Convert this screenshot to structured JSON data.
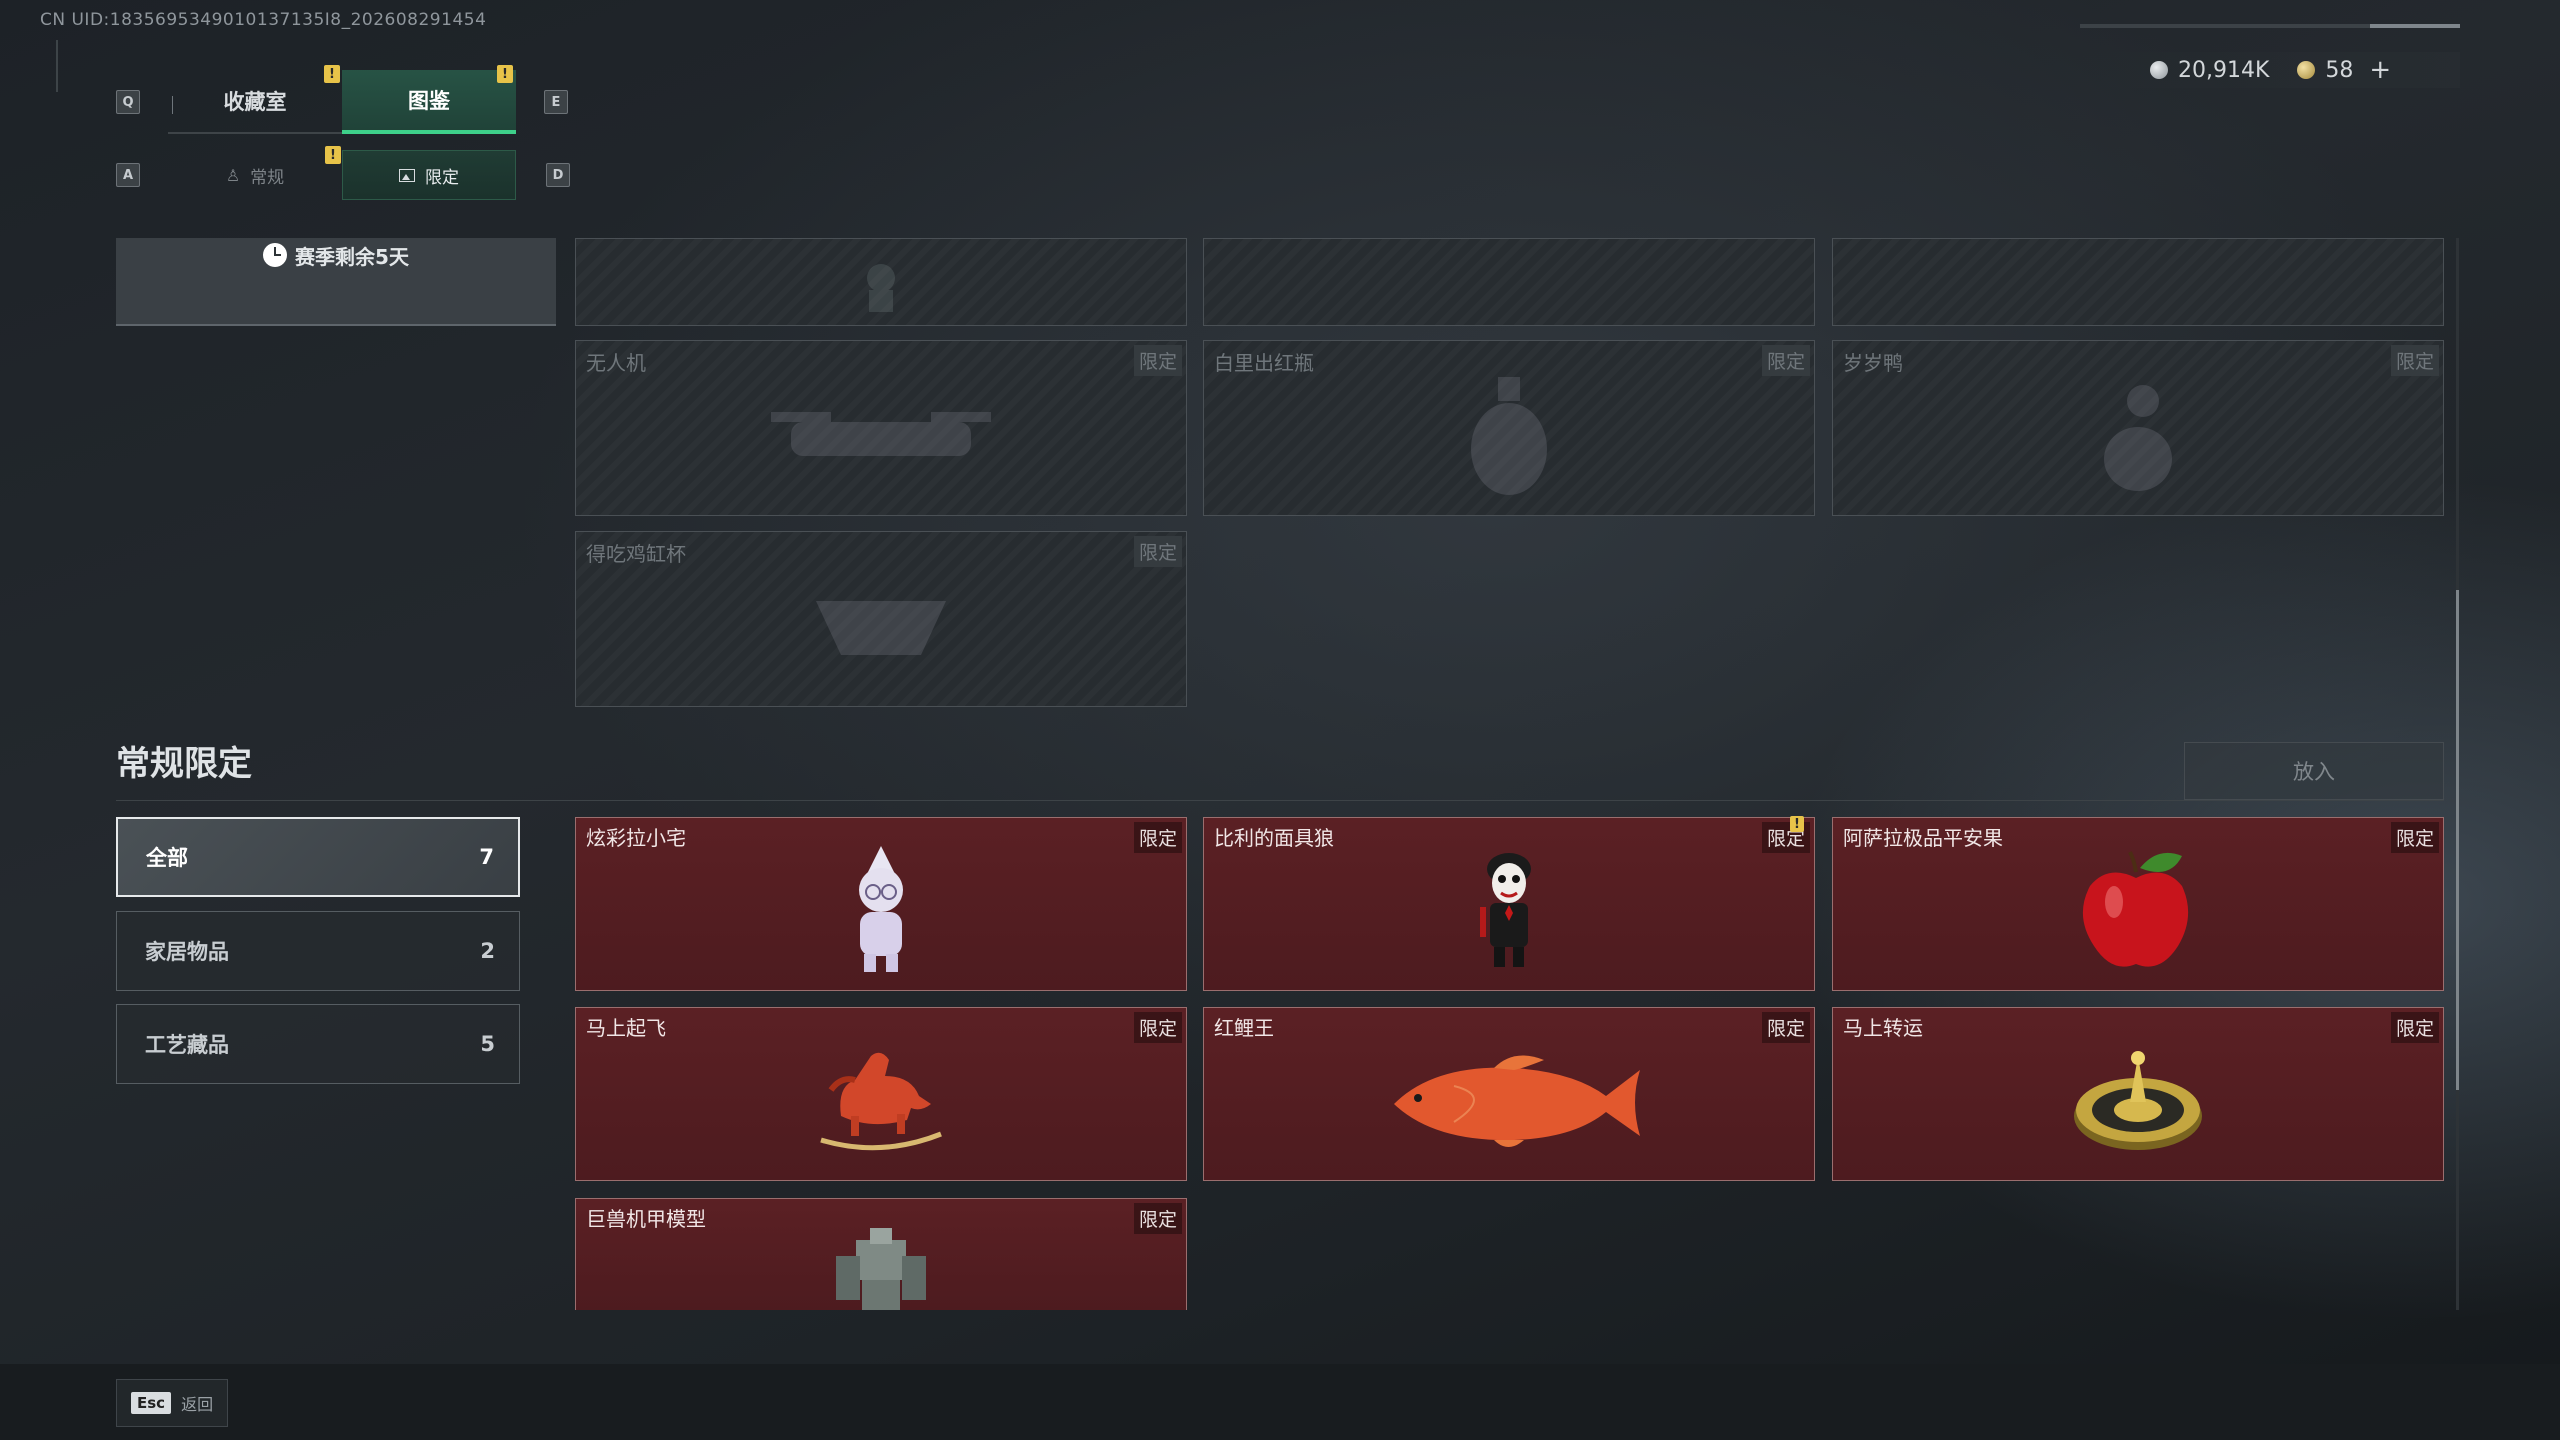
{
  "uid_text": "CN UID:1835695349010137135I8_202608291454",
  "keys": {
    "q": "Q",
    "e": "E",
    "a": "A",
    "d": "D",
    "esc": "Esc"
  },
  "tabs": [
    {
      "label": "收藏室",
      "active": false,
      "alert": "!"
    },
    {
      "label": "图鉴",
      "active": true,
      "alert": "!"
    }
  ],
  "subtabs": [
    {
      "label": "常规",
      "active": false,
      "icon": "figure-icon",
      "alert": "!"
    },
    {
      "label": "限定",
      "active": true,
      "icon": "image-icon"
    }
  ],
  "currency": {
    "silver": "20,914K",
    "gold": "58",
    "plus": "+"
  },
  "season": {
    "text": "赛季剩余5天"
  },
  "locked_items": [
    {
      "name": "",
      "tag": ""
    },
    {
      "name": "",
      "tag": ""
    },
    {
      "name": "",
      "tag": ""
    },
    {
      "name": "无人机",
      "tag": "限定"
    },
    {
      "name": "白里出红瓶",
      "tag": "限定"
    },
    {
      "name": "岁岁鸭",
      "tag": "限定"
    },
    {
      "name": "得吃鸡缸杯",
      "tag": "限定"
    }
  ],
  "section": {
    "title": "常规限定",
    "put_in": "放入"
  },
  "filters": [
    {
      "label": "全部",
      "count": "7",
      "active": true
    },
    {
      "label": "家居物品",
      "count": "2",
      "active": false
    },
    {
      "label": "工艺藏品",
      "count": "5",
      "active": false
    }
  ],
  "items": [
    {
      "name": "炫彩拉小宅",
      "tag": "限定",
      "icon": "figurine-icon"
    },
    {
      "name": "比利的面具狼",
      "tag": "限定",
      "icon": "mask-doll-icon",
      "alert": "!"
    },
    {
      "name": "阿萨拉极品平安果",
      "tag": "限定",
      "icon": "apple-icon"
    },
    {
      "name": "马上起飞",
      "tag": "限定",
      "icon": "horse-icon"
    },
    {
      "name": "红鲤王",
      "tag": "限定",
      "icon": "carp-icon"
    },
    {
      "name": "马上转运",
      "tag": "限定",
      "icon": "wheel-icon"
    },
    {
      "name": "巨兽机甲模型",
      "tag": "限定",
      "icon": "mech-icon"
    }
  ],
  "footer": {
    "back_label": "返回"
  },
  "colors": {
    "accent_green": "#3ed08a",
    "card_red": "#5b2024",
    "alert_yellow": "#e7c349"
  }
}
